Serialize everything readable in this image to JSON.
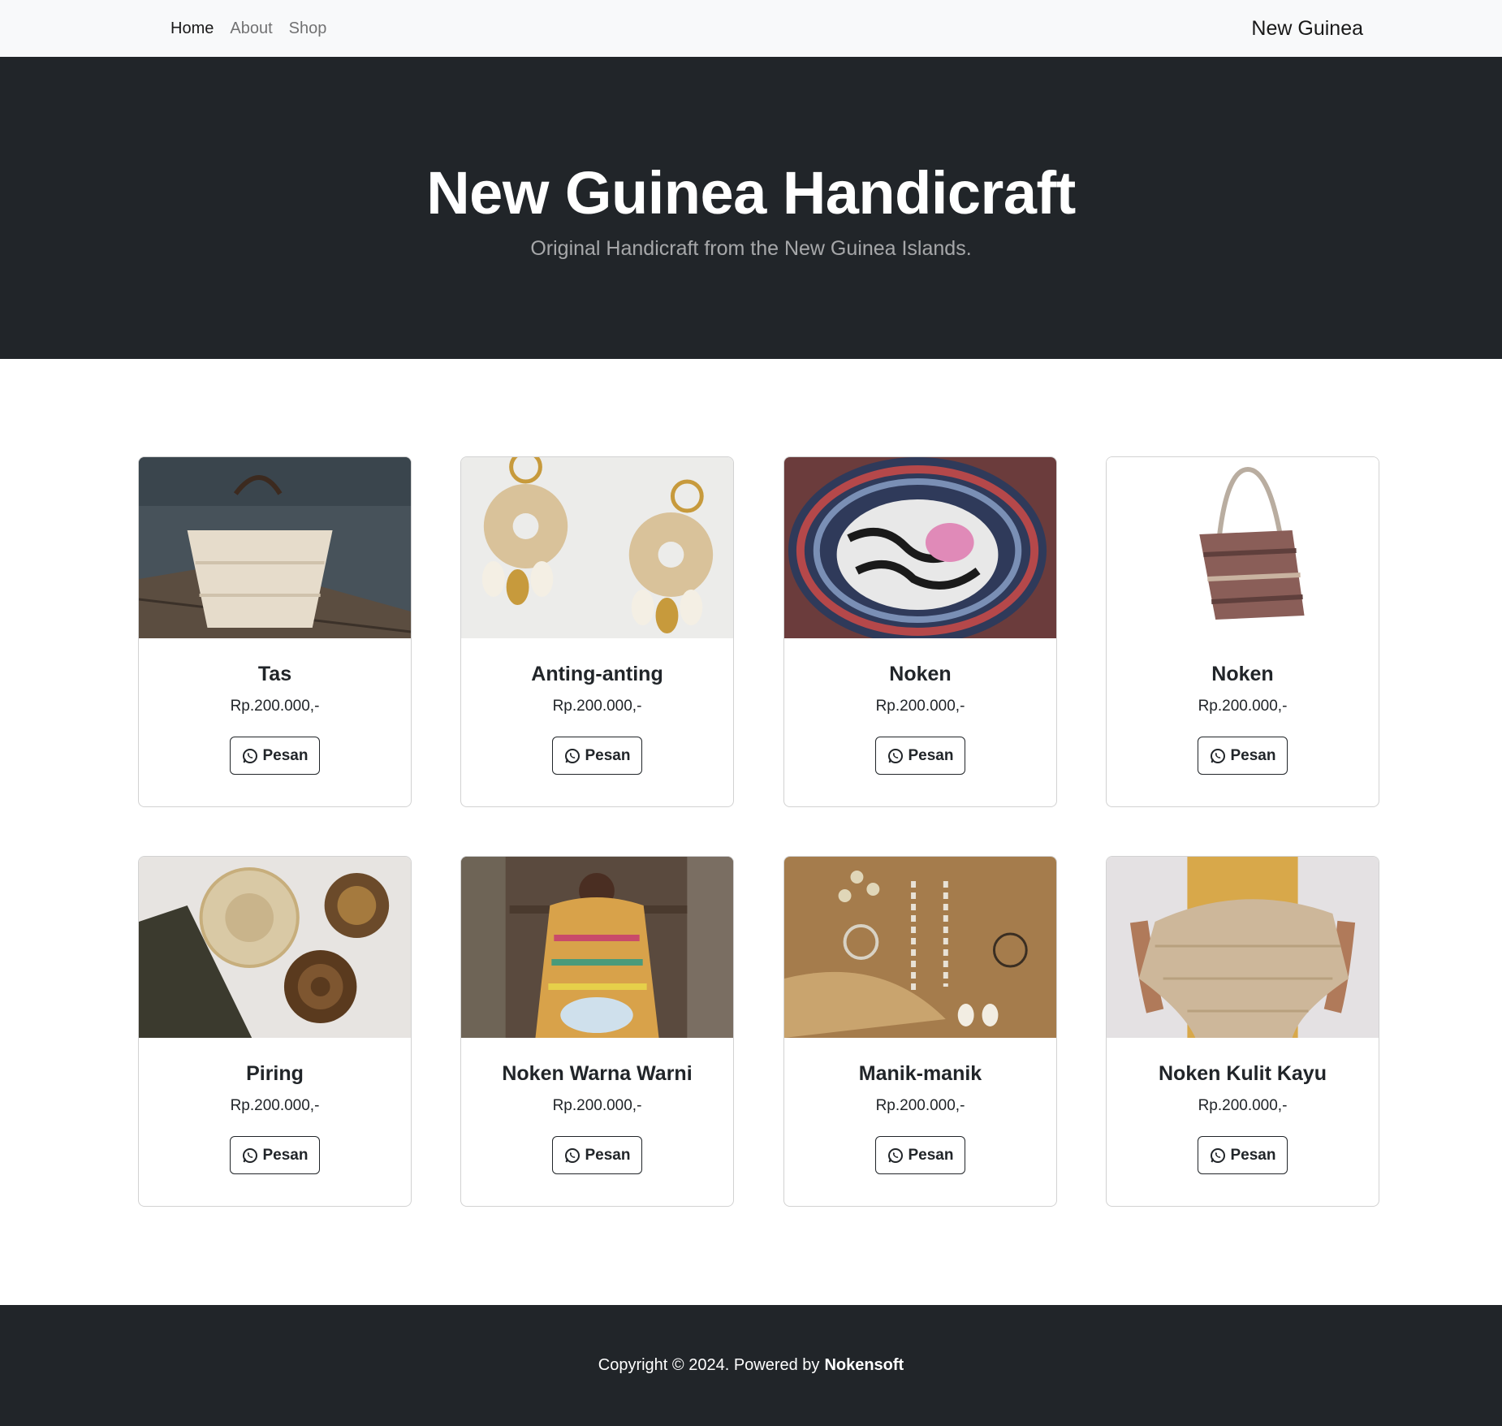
{
  "navbar": {
    "links": [
      {
        "label": "Home",
        "active": true
      },
      {
        "label": "About",
        "active": false
      },
      {
        "label": "Shop",
        "active": false
      }
    ],
    "brand": "New Guinea"
  },
  "hero": {
    "title": "New Guinea Handicraft",
    "subtitle": "Original Handicraft from the New Guinea Islands."
  },
  "colors": {
    "dark": "#212529",
    "light": "#f8f9fa"
  },
  "products": [
    {
      "name": "Tas",
      "price": "Rp.200.000,-",
      "button": "Pesan",
      "icon": "whatsapp-icon"
    },
    {
      "name": "Anting-anting",
      "price": "Rp.200.000,-",
      "button": "Pesan",
      "icon": "whatsapp-icon"
    },
    {
      "name": "Noken",
      "price": "Rp.200.000,-",
      "button": "Pesan",
      "icon": "whatsapp-icon"
    },
    {
      "name": "Noken",
      "price": "Rp.200.000,-",
      "button": "Pesan",
      "icon": "whatsapp-icon"
    },
    {
      "name": "Piring",
      "price": "Rp.200.000,-",
      "button": "Pesan",
      "icon": "whatsapp-icon"
    },
    {
      "name": "Noken Warna Warni",
      "price": "Rp.200.000,-",
      "button": "Pesan",
      "icon": "whatsapp-icon"
    },
    {
      "name": "Manik-manik",
      "price": "Rp.200.000,-",
      "button": "Pesan",
      "icon": "whatsapp-icon"
    },
    {
      "name": "Noken Kulit Kayu",
      "price": "Rp.200.000,-",
      "button": "Pesan",
      "icon": "whatsapp-icon"
    }
  ],
  "footer": {
    "text": "Copyright © 2024. Powered by",
    "brand": "Nokensoft"
  }
}
